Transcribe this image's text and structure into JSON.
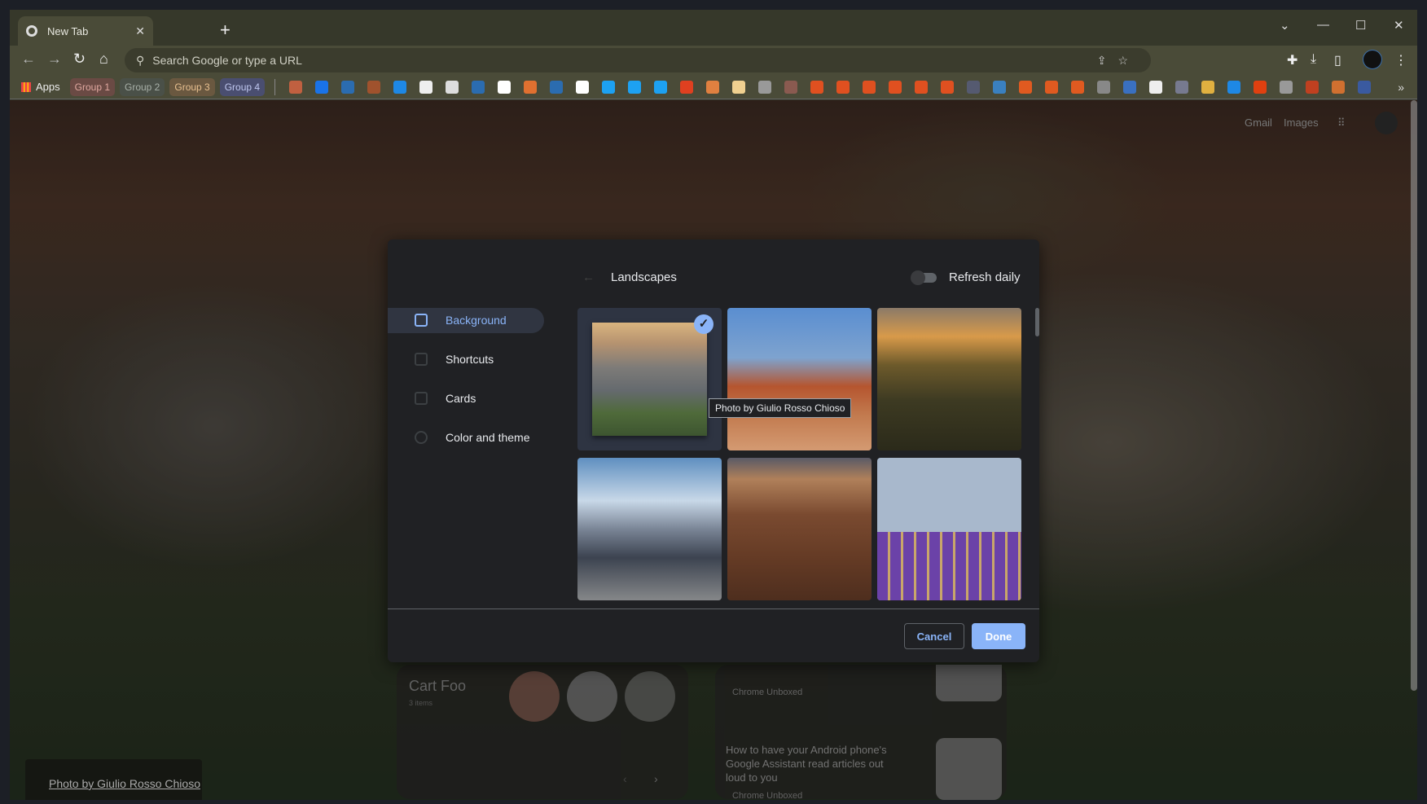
{
  "browser": {
    "tab_title": "New Tab",
    "omnibox_placeholder": "Search Google or type a URL"
  },
  "bookmarks": {
    "apps_label": "Apps",
    "groups": [
      {
        "label": "Group 1",
        "bg": "#6a4a44",
        "fg": "#e0a8a0"
      },
      {
        "label": "Group 2",
        "bg": "#4a5048",
        "fg": "#a8b0a8"
      },
      {
        "label": "Group 3",
        "bg": "#6a5840",
        "fg": "#e8c090"
      },
      {
        "label": "Group 4",
        "bg": "#4a4e70",
        "fg": "#c0c8f0"
      }
    ],
    "icon_colors": [
      "#c06040",
      "#1a73e8",
      "#2b6cb0",
      "#a0522d",
      "#1e88e5",
      "#eeeeee",
      "#dddddd",
      "#2b6cb0",
      "#ffffff",
      "#e07030",
      "#2b6cb0",
      "#ffffff",
      "#1da1f2",
      "#1da1f2",
      "#1da1f2",
      "#e04020",
      "#e08040",
      "#f0d090",
      "#999999",
      "#8a5a50",
      "#e05020",
      "#e05020",
      "#e05020",
      "#e05020",
      "#e05020",
      "#e05020",
      "#555a70",
      "#3a80c0",
      "#e05a20",
      "#e05a20",
      "#e05a20",
      "#888888",
      "#3a70c0",
      "#eeeeee",
      "#777a90",
      "#e0b040",
      "#1e88e5",
      "#e04010",
      "#999999",
      "#c04020",
      "#d07030",
      "#3a5aa0"
    ]
  },
  "ntp": {
    "gmail": "Gmail",
    "images": "Images",
    "photo_credit": "Photo by Giulio Rosso Chioso",
    "cart_card": {
      "title": "Cart Foo",
      "subtitle": "3 items"
    },
    "news_card": {
      "source": "Chrome Unboxed",
      "article": "How to have your Android phone's Google Assistant read articles out loud to you",
      "source2": "Chrome Unboxed"
    }
  },
  "dialog": {
    "sidebar": [
      "Background",
      "Shortcuts",
      "Cards",
      "Color and theme"
    ],
    "header": "Landscapes",
    "refresh_label": "Refresh daily",
    "tooltip": "Photo by Giulio Rosso Chioso",
    "cancel": "Cancel",
    "done": "Done",
    "accent": "#8ab4f8"
  }
}
